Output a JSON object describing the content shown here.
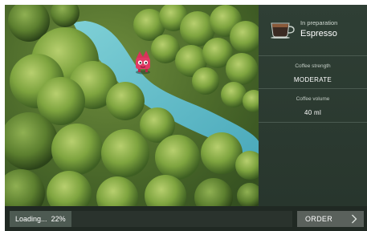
{
  "preparation": {
    "status_label": "In preparation",
    "drink_name": "Espresso",
    "cup_icon": "espresso-cup-icon"
  },
  "settings": [
    {
      "label": "Coffee strength",
      "value": "MODERATE"
    },
    {
      "label": "Coffee volume",
      "value": "40 ml"
    }
  ],
  "loading": {
    "label": "Loading...",
    "percent_text": "22%",
    "progress": 0.22
  },
  "order_button": {
    "label": "ORDER",
    "icon": "chevron-right-icon"
  },
  "colors": {
    "panel": "#2f3f35",
    "river": "#5fb8c4",
    "broccoli": "#6f9a3a",
    "mascot": "#d8325a"
  }
}
